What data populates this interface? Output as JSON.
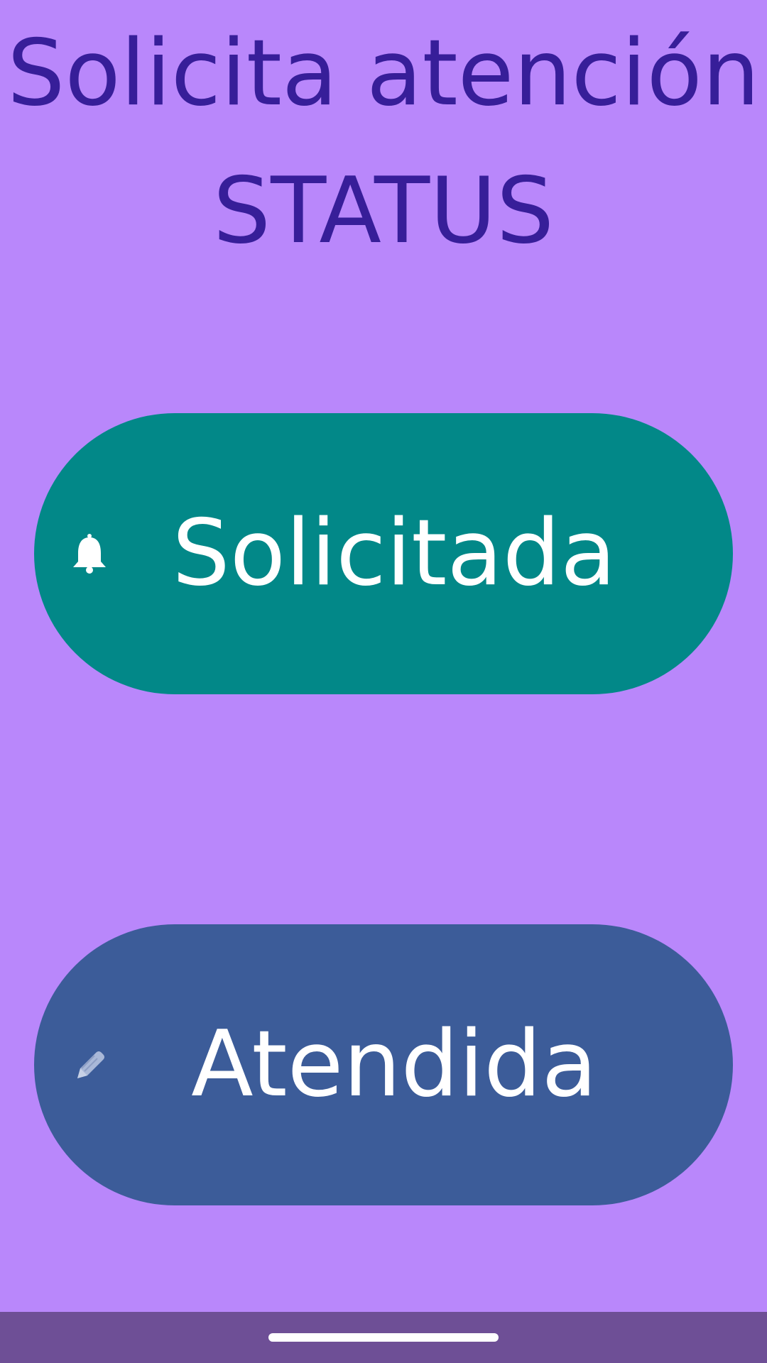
{
  "header": {
    "title_line1": "Solicita atención",
    "title_line2": "STATUS"
  },
  "buttons": [
    {
      "label": "Solicitada",
      "icon": "bell-icon",
      "color": "#028888"
    },
    {
      "label": "Atendida",
      "icon": "pencil-icon",
      "color": "#3C5C99"
    }
  ],
  "colors": {
    "background": "#B987FB",
    "title_text": "#371E99",
    "button_text": "#FFFFFF",
    "nav_bar": "#6E4F96"
  }
}
